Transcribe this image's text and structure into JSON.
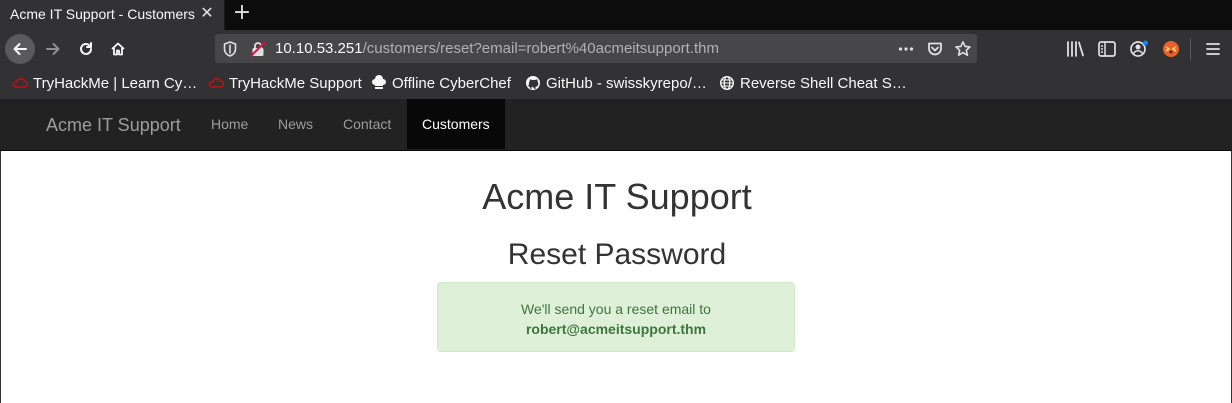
{
  "browser": {
    "tab_title": "Acme IT Support - Customers",
    "url_host": "10.10.53.251",
    "url_path": "/customers/reset?email=robert%40acmeitsupport.thm",
    "bookmarks": [
      {
        "label": "TryHackMe | Learn Cy…",
        "icon": "tryhackme-icon"
      },
      {
        "label": "TryHackMe Support",
        "icon": "tryhackme-icon"
      },
      {
        "label": "Offline CyberChef",
        "icon": "chef-hat-icon"
      },
      {
        "label": "GitHub - swisskyrepo/…",
        "icon": "github-icon"
      },
      {
        "label": "Reverse Shell Cheat S…",
        "icon": "globe-icon"
      }
    ]
  },
  "site": {
    "brand": "Acme IT Support",
    "nav": [
      {
        "label": "Home"
      },
      {
        "label": "News"
      },
      {
        "label": "Contact"
      },
      {
        "label": "Customers",
        "active": true
      }
    ]
  },
  "page": {
    "heading": "Acme IT Support",
    "subheading": "Reset Password",
    "alert_line1": "We'll send you a reset email to",
    "alert_email": "robert@acmeitsupport.thm"
  },
  "colors": {
    "alert_bg": "#dff0d8",
    "alert_text": "#3c763d",
    "navbar_bg": "#222222"
  }
}
